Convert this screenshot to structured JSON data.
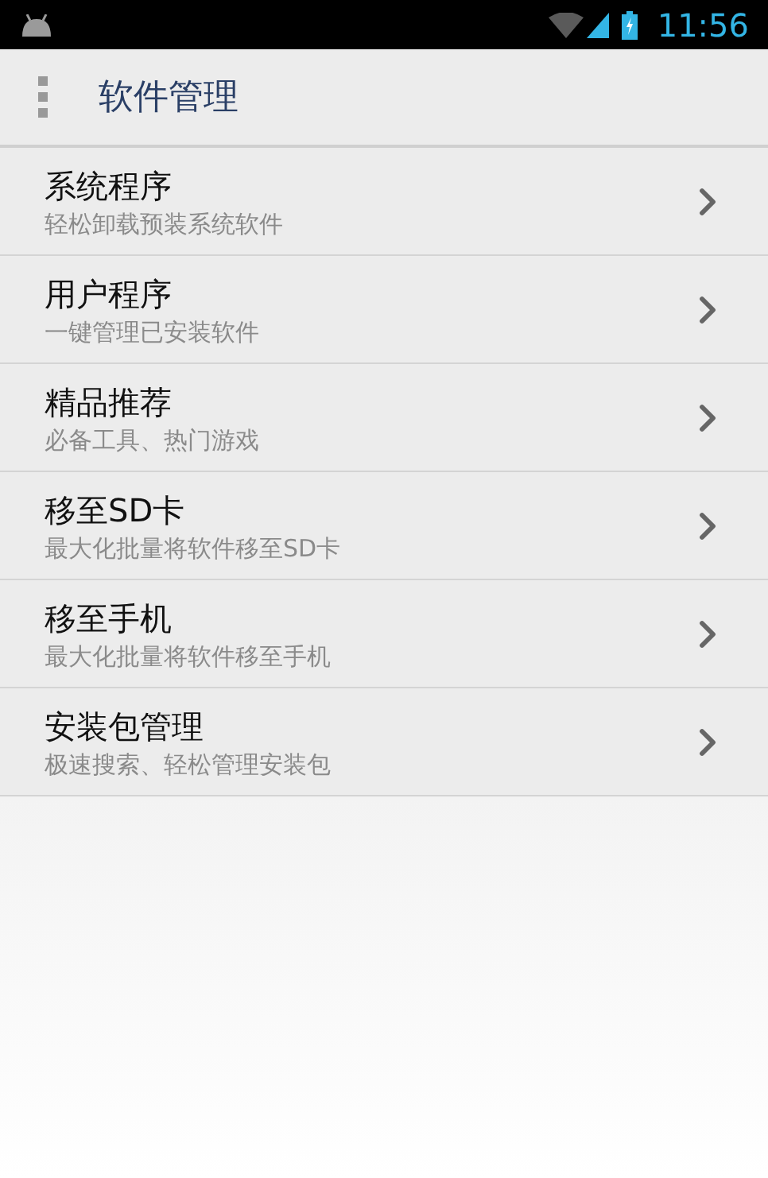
{
  "status_bar": {
    "time": "11:56"
  },
  "app_bar": {
    "title": "软件管理"
  },
  "menu_items": [
    {
      "title": "系统程序",
      "subtitle": "轻松卸载预装系统软件"
    },
    {
      "title": "用户程序",
      "subtitle": "一键管理已安装软件"
    },
    {
      "title": "精品推荐",
      "subtitle": "必备工具、热门游戏"
    },
    {
      "title": "移至SD卡",
      "subtitle": "最大化批量将软件移至SD卡"
    },
    {
      "title": "移至手机",
      "subtitle": "最大化批量将软件移至手机"
    },
    {
      "title": "安装包管理",
      "subtitle": "极速搜索、轻松管理安装包"
    }
  ]
}
